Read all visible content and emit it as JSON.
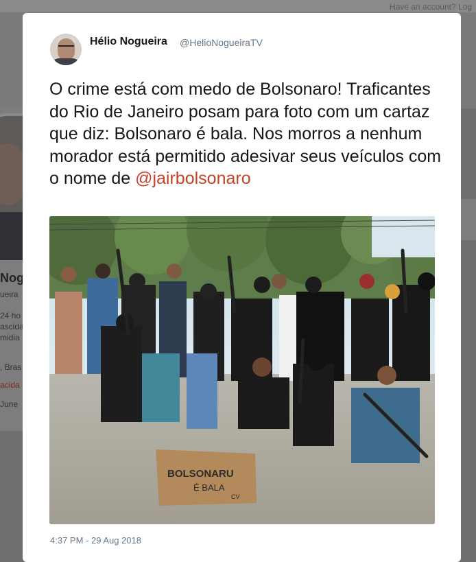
{
  "background_page": {
    "account_link": "Have an account? Log",
    "profile_name": "Nogu",
    "profile_handle": "ueira",
    "bio_lines": [
      "24 ho",
      "ascida",
      "midia"
    ],
    "location": ", Bras",
    "website": "acida",
    "joined": "June"
  },
  "tweet": {
    "author": {
      "name": "Hélio Nogueira",
      "handle": "@HelioNogueiraTV"
    },
    "text": "O crime está com medo de Bolsonaro! Traficantes do Rio de Janeiro posam para foto com um cartaz que diz: Bolsonaro é bala. Nos morros a nenhum morador está permitido adesivar seus veículos com o nome de ",
    "mention": "@jairbolsonaro",
    "image": {
      "sign_line1": "BOLSONARU",
      "sign_line2": "É BALA",
      "sign_line3": "CV"
    },
    "timestamp": "4:37 PM - 29 Aug 2018"
  },
  "colors": {
    "mention": "#c4412a",
    "handle_gray": "#657786",
    "overlay": "#6f6f6f"
  }
}
